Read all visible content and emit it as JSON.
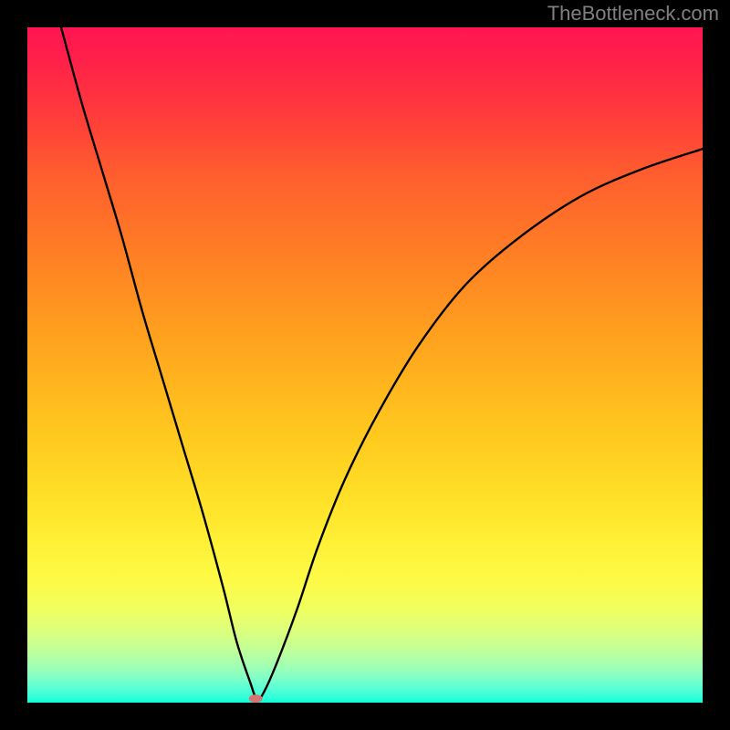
{
  "watermark": "TheBottleneck.com",
  "chart_data": {
    "type": "line",
    "title": "",
    "xlabel": "",
    "ylabel": "",
    "xlim": [
      0,
      100
    ],
    "ylim": [
      0,
      100
    ],
    "grid": false,
    "legend": null,
    "series": [
      {
        "name": "bottleneck-curve",
        "type": "line",
        "color": "#000000",
        "x": [
          5,
          8,
          11,
          14,
          17,
          20,
          23,
          26,
          29,
          31,
          33,
          34,
          35,
          37,
          40,
          43,
          47,
          52,
          58,
          65,
          73,
          82,
          91,
          100
        ],
        "values": [
          100,
          89,
          79,
          69,
          58,
          48,
          38,
          28,
          17,
          9,
          3,
          0.5,
          1.5,
          6,
          14,
          23,
          33,
          43,
          53,
          62,
          69,
          75,
          79,
          82
        ]
      }
    ],
    "marker": {
      "x": 33.8,
      "y": 0.6,
      "color": "#d87372",
      "rx": 1.0,
      "ry": 0.6
    },
    "background_gradient": {
      "top": "#ff1552",
      "bottom": "#0affd7",
      "stops": [
        "red-pink",
        "orange",
        "yellow",
        "green-cyan"
      ]
    }
  }
}
